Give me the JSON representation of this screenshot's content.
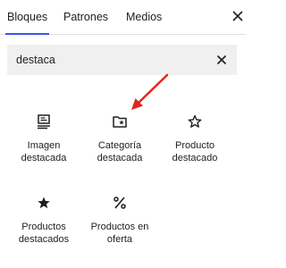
{
  "tabs": [
    {
      "label": "Bloques",
      "active": true
    },
    {
      "label": "Patrones",
      "active": false
    },
    {
      "label": "Medios",
      "active": false
    }
  ],
  "search": {
    "value": "destaca"
  },
  "blocks": [
    {
      "label": "Imagen destacada",
      "icon": "featured-image-icon"
    },
    {
      "label": "Categoría destacada",
      "icon": "featured-category-icon"
    },
    {
      "label": "Producto destacado",
      "icon": "star-outline-icon"
    },
    {
      "label": "Productos destacados",
      "icon": "star-filled-icon"
    },
    {
      "label": "Productos en oferta",
      "icon": "percent-icon"
    }
  ],
  "colors": {
    "accent": "#3858e9",
    "annotation_arrow": "#e3261c",
    "search_bg": "#f0f0f0"
  }
}
